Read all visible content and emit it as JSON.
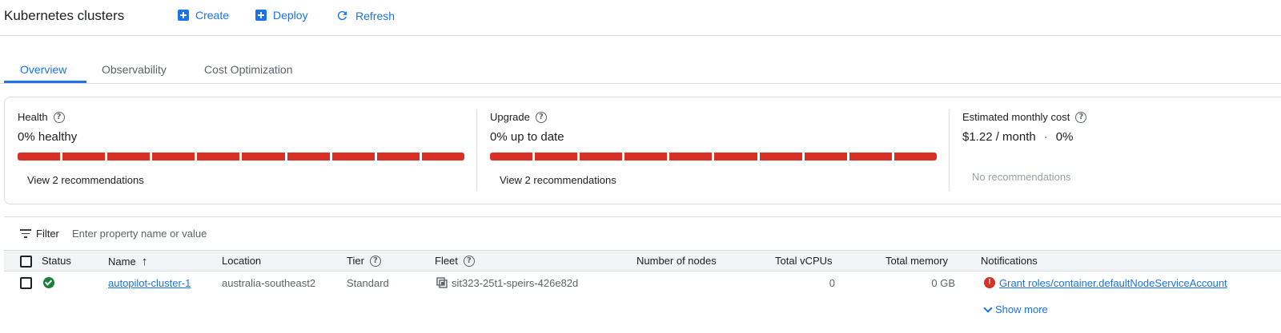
{
  "header": {
    "title": "Kubernetes clusters",
    "create_label": "Create",
    "deploy_label": "Deploy",
    "refresh_label": "Refresh"
  },
  "tabs": [
    {
      "label": "Overview",
      "active": true
    },
    {
      "label": "Observability",
      "active": false
    },
    {
      "label": "Cost Optimization",
      "active": false
    }
  ],
  "summary": {
    "health": {
      "label": "Health",
      "value": "0% healthy",
      "link": "View 2 recommendations",
      "bar_segments": 10,
      "bar_color": "#d93025"
    },
    "upgrade": {
      "label": "Upgrade",
      "value": "0% up to date",
      "link": "View 2 recommendations",
      "bar_segments": 10,
      "bar_color": "#d93025"
    },
    "cost": {
      "label": "Estimated monthly cost",
      "value": "$1.22 / month",
      "separator": "·",
      "percent": "0%",
      "recommendations": "No recommendations"
    }
  },
  "filter": {
    "label": "Filter",
    "placeholder": "Enter property name or value"
  },
  "table": {
    "columns": [
      "Status",
      "Name",
      "Location",
      "Tier",
      "Fleet",
      "Number of nodes",
      "Total vCPUs",
      "Total memory",
      "Notifications"
    ],
    "sort_indicator": "↑",
    "rows": [
      {
        "status": "ok",
        "name": "autopilot-cluster-1",
        "location": "australia-southeast2",
        "tier": "Standard",
        "fleet": "sit323-25t1-speirs-426e82d",
        "nodes": "",
        "vcpus": "0",
        "memory": "0 GB",
        "notification": "Grant roles/container.defaultNodeServiceAccount",
        "show_more": "Show more"
      }
    ]
  },
  "colors": {
    "accent": "#1a73e8",
    "error": "#d93025",
    "success": "#188038"
  },
  "icons": {
    "create": "add-box-icon",
    "deploy": "add-box-icon",
    "refresh": "refresh-icon",
    "help": "help-circle-icon",
    "filter": "filter-list-icon",
    "status_ok": "check-circle-icon",
    "error": "error-icon",
    "fleet": "fleet-icon",
    "expand": "chevron-down-icon"
  }
}
